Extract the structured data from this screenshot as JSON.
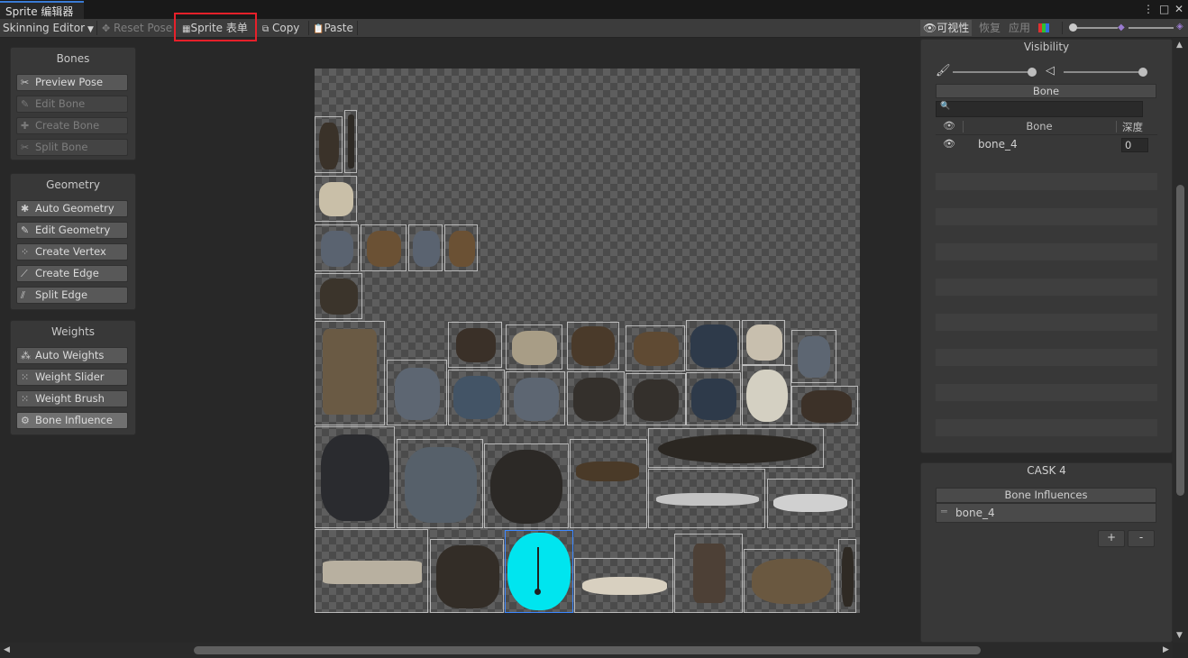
{
  "window": {
    "tab_title": "Sprite 编辑器",
    "more_icon": "⋮",
    "maximize_icon": "□",
    "close_icon": "✕"
  },
  "toolbar": {
    "mode_dropdown": "Skinning Editor",
    "reset_pose": "Reset Pose",
    "sprite_sheet": "Sprite 表单",
    "copy": "Copy",
    "paste": "Paste",
    "visibility": "可视性",
    "revert": "恢复",
    "apply": "应用",
    "highlighted_item": "Sprite 表单",
    "highlight_color": "#e8202a"
  },
  "bones_panel": {
    "title": "Bones",
    "buttons": [
      {
        "label": "Preview Pose",
        "enabled": true,
        "icon": "preview-pose-icon"
      },
      {
        "label": "Edit Bone",
        "enabled": false,
        "icon": "edit-bone-icon"
      },
      {
        "label": "Create Bone",
        "enabled": false,
        "icon": "create-bone-icon"
      },
      {
        "label": "Split Bone",
        "enabled": false,
        "icon": "split-bone-icon"
      }
    ]
  },
  "geometry_panel": {
    "title": "Geometry",
    "buttons": [
      {
        "label": "Auto Geometry",
        "icon": "auto-geometry-icon"
      },
      {
        "label": "Edit Geometry",
        "icon": "edit-geometry-icon"
      },
      {
        "label": "Create Vertex",
        "icon": "create-vertex-icon"
      },
      {
        "label": "Create Edge",
        "icon": "create-edge-icon"
      },
      {
        "label": "Split Edge",
        "icon": "split-edge-icon"
      }
    ]
  },
  "weights_panel": {
    "title": "Weights",
    "buttons": [
      {
        "label": "Auto Weights",
        "icon": "auto-weights-icon"
      },
      {
        "label": "Weight Slider",
        "icon": "weight-slider-icon"
      },
      {
        "label": "Weight Brush",
        "icon": "weight-brush-icon"
      },
      {
        "label": "Bone Influence",
        "icon": "bone-influence-icon",
        "active": true
      }
    ]
  },
  "visibility_panel": {
    "title": "Visibility",
    "tab_label": "Bone",
    "search_placeholder": "",
    "columns": {
      "name": "Bone",
      "depth": "深度"
    },
    "rows": [
      {
        "name": "bone_4",
        "depth": "0"
      }
    ]
  },
  "sprite_panel": {
    "title": "CASK 4",
    "influences_header": "Bone Influences",
    "influences": [
      "bone_4"
    ],
    "add_label": "+",
    "remove_label": "-"
  },
  "colors": {
    "selected_sprite": "#00e5ef",
    "canvas_dark": "#4b4b4b",
    "canvas_light": "#5e5e5e"
  }
}
